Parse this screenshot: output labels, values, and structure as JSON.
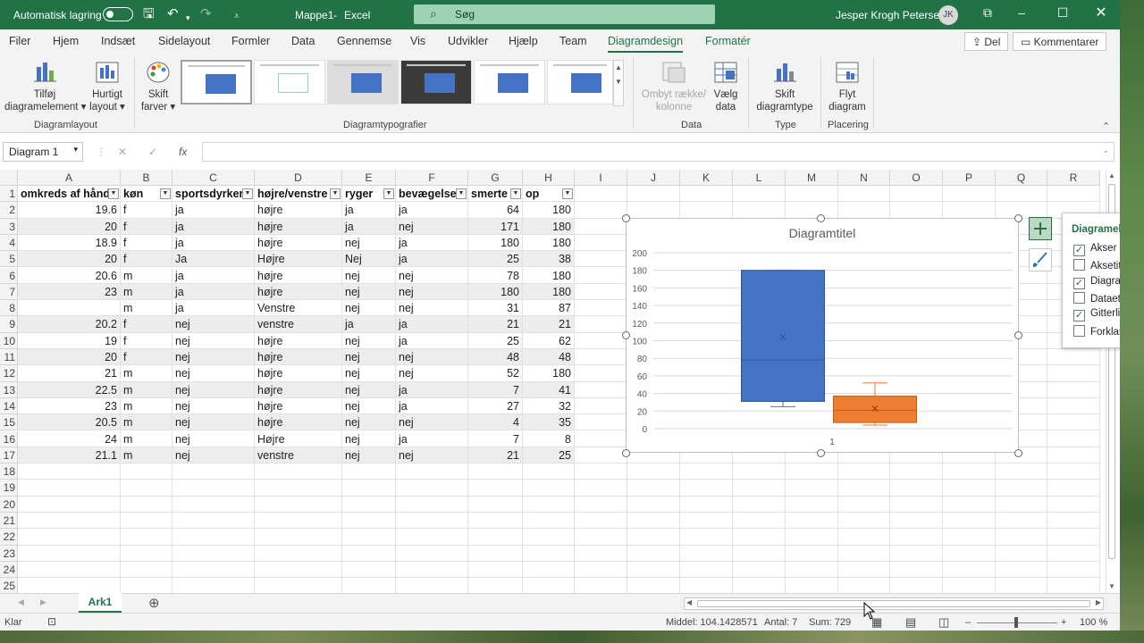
{
  "titlebar": {
    "autosave": "Automatisk lagring",
    "filename": "Mappe1",
    "separator": "-",
    "app": "Excel",
    "search": "Søg",
    "user": "Jesper Krogh Petersen",
    "initials": "JK"
  },
  "menu_tabs": [
    "Filer",
    "Hjem",
    "Indsæt",
    "Sidelayout",
    "Formler",
    "Data",
    "Gennemse",
    "Vis",
    "Udvikler",
    "Hjælp",
    "Team",
    "Diagramdesign",
    "Formatér"
  ],
  "share": {
    "share": "Del",
    "comments": "Kommentarer"
  },
  "ribbon": {
    "add_element": "Tilføj",
    "add_element2": "diagramelement",
    "quick_layout": "Hurtigt",
    "quick_layout2": "layout",
    "change_colors": "Skift",
    "change_colors2": "farver",
    "switch_row_col": "Ombyt række/",
    "switch_row_col2": "kolonne",
    "select_data": "Vælg",
    "select_data2": "data",
    "change_type": "Skift",
    "change_type2": "diagramtype",
    "move_chart": "Flyt",
    "move_chart2": "diagram",
    "groups": {
      "layout": "Diagramlayout",
      "styles": "Diagramtypografier",
      "data": "Data",
      "type": "Type",
      "placement": "Placering"
    }
  },
  "namebox": "Diagram 1",
  "columns": [
    "A",
    "B",
    "C",
    "D",
    "E",
    "F",
    "G",
    "H",
    "I",
    "J",
    "K",
    "L",
    "M",
    "N",
    "O",
    "P",
    "Q",
    "R"
  ],
  "headers": [
    "omkreds af hånd",
    "køn",
    "sportsdyrker",
    "højre/venstre",
    "ryger",
    "bevægelse",
    "smerte",
    "op"
  ],
  "rows": [
    [
      "19.6",
      "f",
      "ja",
      "højre",
      "ja",
      "ja",
      "64",
      "180"
    ],
    [
      "20",
      "f",
      "ja",
      "højre",
      "ja",
      "nej",
      "171",
      "180"
    ],
    [
      "18.9",
      "f",
      "ja",
      "højre",
      "nej",
      "ja",
      "180",
      "180"
    ],
    [
      "20",
      "f",
      "Ja",
      "Højre",
      "Nej",
      "ja",
      "25",
      "38"
    ],
    [
      "20.6",
      "m",
      "ja",
      "højre",
      "nej",
      "nej",
      "78",
      "180"
    ],
    [
      "23",
      "m",
      "ja",
      "højre",
      "nej",
      "nej",
      "180",
      "180"
    ],
    [
      "",
      "m",
      "ja",
      "Venstre",
      "nej",
      "nej",
      "31",
      "87"
    ],
    [
      "20.2",
      "f",
      "nej",
      "venstre",
      "ja",
      "ja",
      "21",
      "21"
    ],
    [
      "19",
      "f",
      "nej",
      "højre",
      "nej",
      "ja",
      "25",
      "62"
    ],
    [
      "20",
      "f",
      "nej",
      "højre",
      "nej",
      "nej",
      "48",
      "48"
    ],
    [
      "21",
      "m",
      "nej",
      "højre",
      "nej",
      "nej",
      "52",
      "180"
    ],
    [
      "22.5",
      "m",
      "nej",
      "højre",
      "nej",
      "ja",
      "7",
      "41"
    ],
    [
      "23",
      "m",
      "nej",
      "højre",
      "nej",
      "ja",
      "27",
      "32"
    ],
    [
      "20.5",
      "m",
      "nej",
      "højre",
      "nej",
      "nej",
      "4",
      "35"
    ],
    [
      "24",
      "m",
      "nej",
      "Højre",
      "nej",
      "ja",
      "7",
      "8"
    ],
    [
      "21.1",
      "m",
      "nej",
      "venstre",
      "nej",
      "nej",
      "21",
      "25"
    ]
  ],
  "row_numbers": [
    "1",
    "2",
    "3",
    "4",
    "5",
    "6",
    "7",
    "8",
    "9",
    "10",
    "11",
    "12",
    "13",
    "14",
    "15",
    "16",
    "17",
    "18",
    "19",
    "20",
    "21",
    "22",
    "23",
    "24",
    "25"
  ],
  "chart_panel": {
    "title": "Diagramelementer",
    "items": [
      {
        "label": "Akser",
        "checked": true
      },
      {
        "label": "Aksetitler",
        "checked": false
      },
      {
        "label": "Diagramtitel",
        "checked": true
      },
      {
        "label": "Dataetiketter",
        "checked": false
      },
      {
        "label": "Gitterlinjer",
        "checked": true
      },
      {
        "label": "Forklaring",
        "checked": false
      }
    ]
  },
  "chart_data": {
    "type": "box",
    "title": "Diagramtitel",
    "categories": [
      "1"
    ],
    "ylim": [
      0,
      200
    ],
    "yticks": [
      0,
      20,
      40,
      60,
      80,
      100,
      120,
      140,
      160,
      180,
      200
    ],
    "grid": true,
    "legend": "none",
    "series": [
      {
        "color": "#4472c4",
        "min": 25,
        "q1": 31,
        "median": 78,
        "q3": 180,
        "max": 180,
        "mean": 104.14
      },
      {
        "color": "#ed7d31",
        "min": 4,
        "q1": 7,
        "median": 21,
        "q3": 37,
        "max": 52,
        "mean": 23
      }
    ]
  },
  "sheet_tab": "Ark1",
  "status": {
    "ready": "Klar",
    "average": "Middel: 104.1428571",
    "count": "Antal: 7",
    "sum": "Sum: 729",
    "zoom": "100 %"
  }
}
